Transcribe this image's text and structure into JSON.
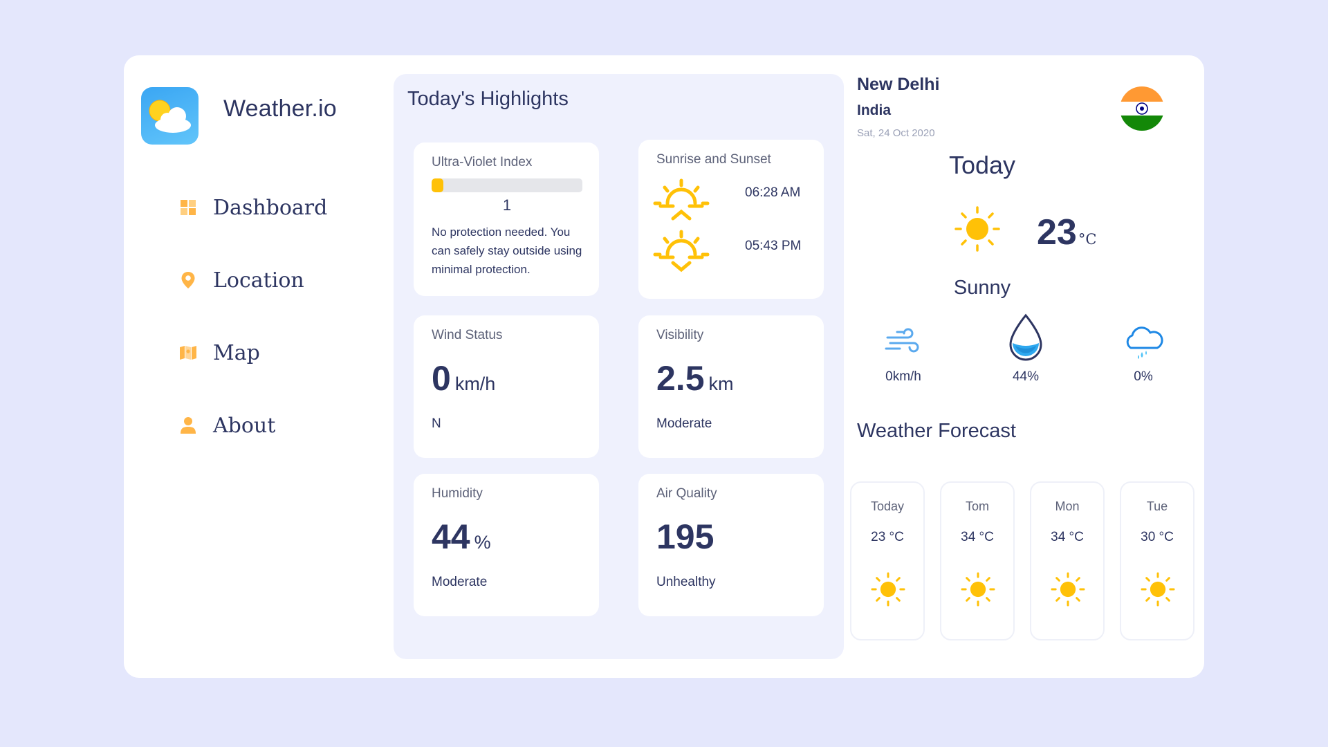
{
  "app": {
    "name": "Weather.io"
  },
  "sidebar": {
    "items": [
      {
        "label": "Dashboard",
        "icon": "grid-icon"
      },
      {
        "label": "Location",
        "icon": "location-pin-icon"
      },
      {
        "label": "Map",
        "icon": "map-icon"
      },
      {
        "label": "About",
        "icon": "user-icon"
      }
    ]
  },
  "highlights": {
    "title": "Today's Highlights",
    "uv": {
      "title": "Ultra-Violet Index",
      "value": "1",
      "level_fraction": 0.08,
      "description": "No protection needed. You can safely stay outside using minimal protection."
    },
    "sun": {
      "title": "Sunrise and Sunset",
      "sunrise": "06:28 AM",
      "sunset": "05:43 PM"
    },
    "wind": {
      "title": "Wind Status",
      "value": "0",
      "unit": "km/h",
      "direction": "N"
    },
    "visibility": {
      "title": "Visibility",
      "value": "2.5",
      "unit": "km",
      "status": "Moderate"
    },
    "humidity": {
      "title": "Humidity",
      "value": "44",
      "unit": "%",
      "status": "Moderate"
    },
    "air_quality": {
      "title": "Air Quality",
      "value": "195",
      "status": "Unhealthy"
    }
  },
  "current": {
    "city": "New Delhi",
    "country": "India",
    "date": "Sat, 24 Oct 2020",
    "heading": "Today",
    "temperature": "23",
    "temp_unit": "°C",
    "condition": "Sunny",
    "wind": "0km/h",
    "humidity": "44%",
    "precipitation": "0%"
  },
  "forecast": {
    "title": "Weather Forecast",
    "days": [
      {
        "day": "Today",
        "temp": "23 °C",
        "icon": "sun-icon"
      },
      {
        "day": "Tom",
        "temp": "34 °C",
        "icon": "sun-icon"
      },
      {
        "day": "Mon",
        "temp": "34 °C",
        "icon": "sun-icon"
      },
      {
        "day": "Tue",
        "temp": "30 °C",
        "icon": "sun-icon"
      }
    ]
  },
  "colors": {
    "background": "#e4e7fc",
    "text": "#2d3561",
    "accent": "#ffc107",
    "nav_icon": "#ffb547"
  }
}
